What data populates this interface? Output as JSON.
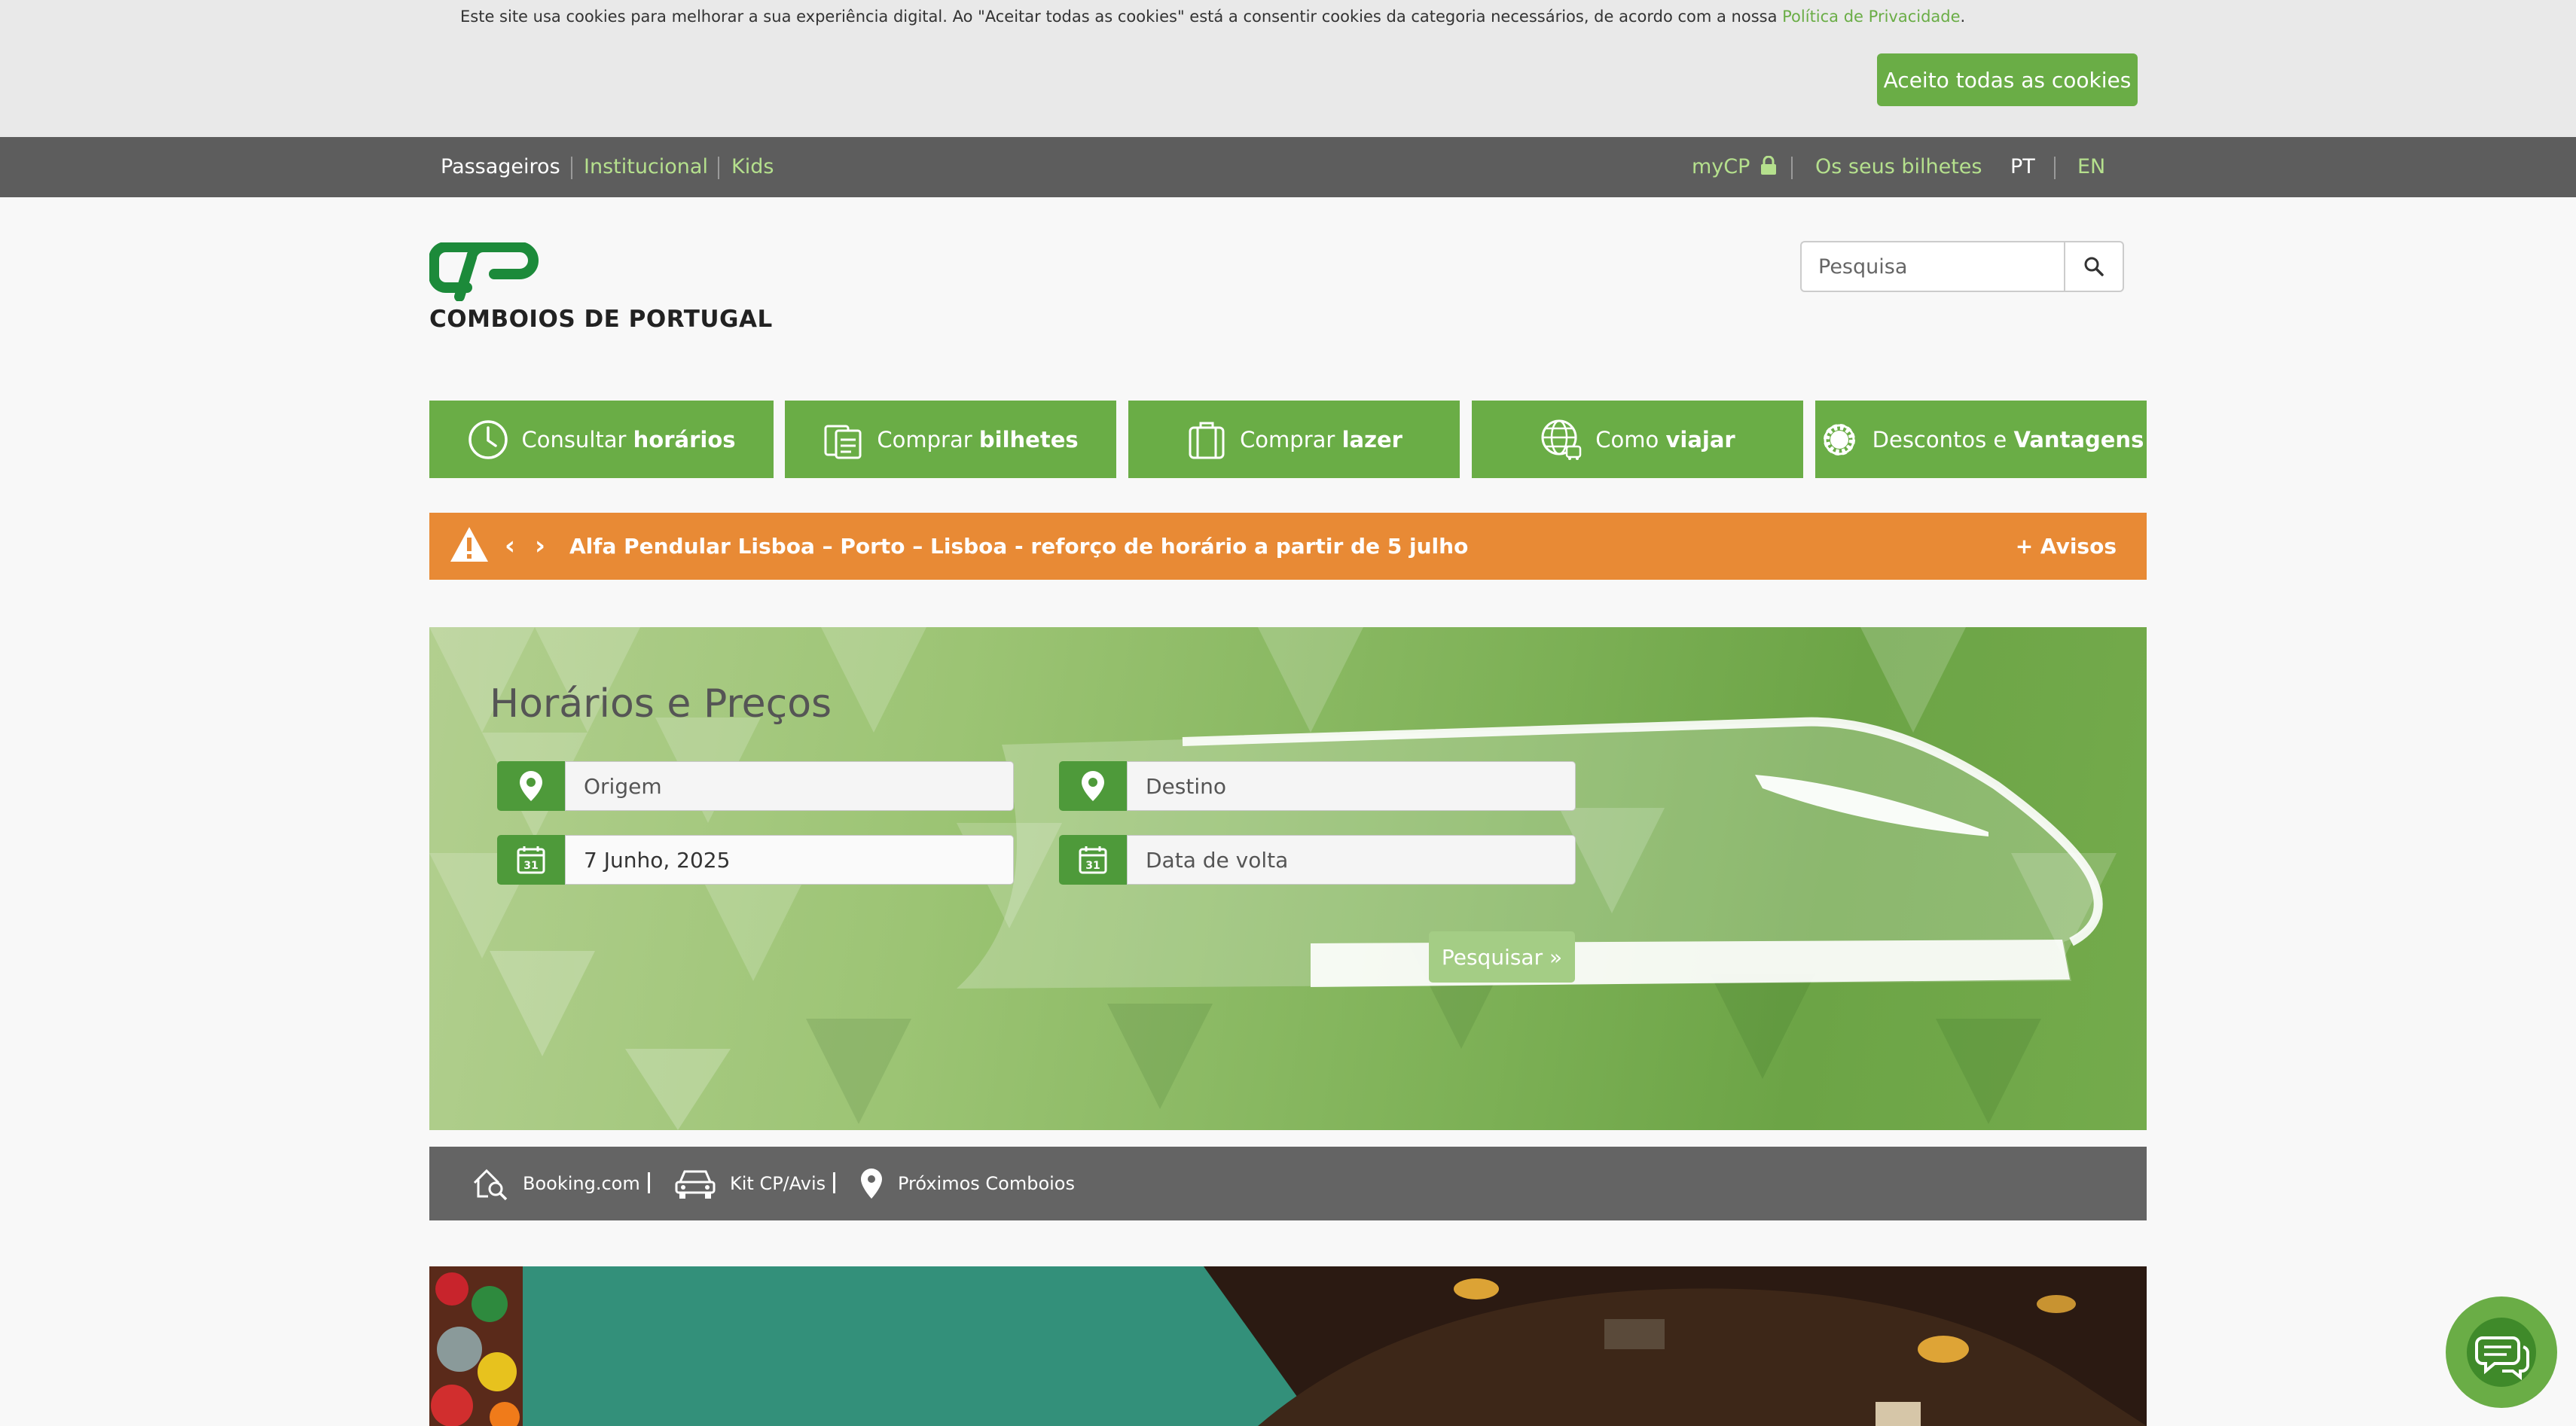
{
  "cookie": {
    "text": "Este site usa cookies para melhorar a sua experiência digital. Ao \"Aceitar todas as cookies\" está a consentir cookies da categoria necessários, de acordo com a nossa ",
    "link": "Política de Privacidade",
    "end": ".",
    "button": "Aceito todas as cookies"
  },
  "topnav": {
    "left": [
      "Passageiros",
      "Institucional",
      "Kids"
    ],
    "mycp": "myCP",
    "tickets": "Os seus bilhetes",
    "lang_pt": "PT",
    "lang_en": "EN"
  },
  "header": {
    "logo_text": "COMBOIOS DE PORTUGAL",
    "search_placeholder": "Pesquisa"
  },
  "menu": [
    {
      "prefix": "Consultar",
      "bold": "horários",
      "icon": "clock-icon"
    },
    {
      "prefix": "Comprar",
      "bold": "bilhetes",
      "icon": "ticket-icon"
    },
    {
      "prefix": "Comprar",
      "bold": "lazer",
      "icon": "suitcase-icon"
    },
    {
      "prefix": "Como",
      "bold": "viajar",
      "icon": "globe-icon"
    },
    {
      "prefix": "Descontos e",
      "bold": "Vantagens",
      "icon": "gear-icon"
    }
  ],
  "alert": {
    "text": "Alfa Pendular Lisboa – Porto – Lisboa - reforço de horário a partir de 5 julho",
    "more": "+ Avisos",
    "prev": "‹",
    "next": "›"
  },
  "search": {
    "title": "Horários e Preços",
    "origin_placeholder": "Origem",
    "destination_placeholder": "Destino",
    "date_value": "7 Junho, 2025",
    "return_placeholder": "Data de volta",
    "calendar_day": "31",
    "submit": "Pesquisar »"
  },
  "quicklinks": {
    "booking": "Booking.com",
    "kit": "Kit CP/Avis",
    "next_trains": "Próximos Comboios"
  },
  "colors": {
    "brand_green": "#6aad46",
    "dark_green": "#4e9a3a",
    "alert_orange": "#e88a35",
    "nav_gray": "#5d5d5d",
    "promo_teal": "#33907a"
  }
}
